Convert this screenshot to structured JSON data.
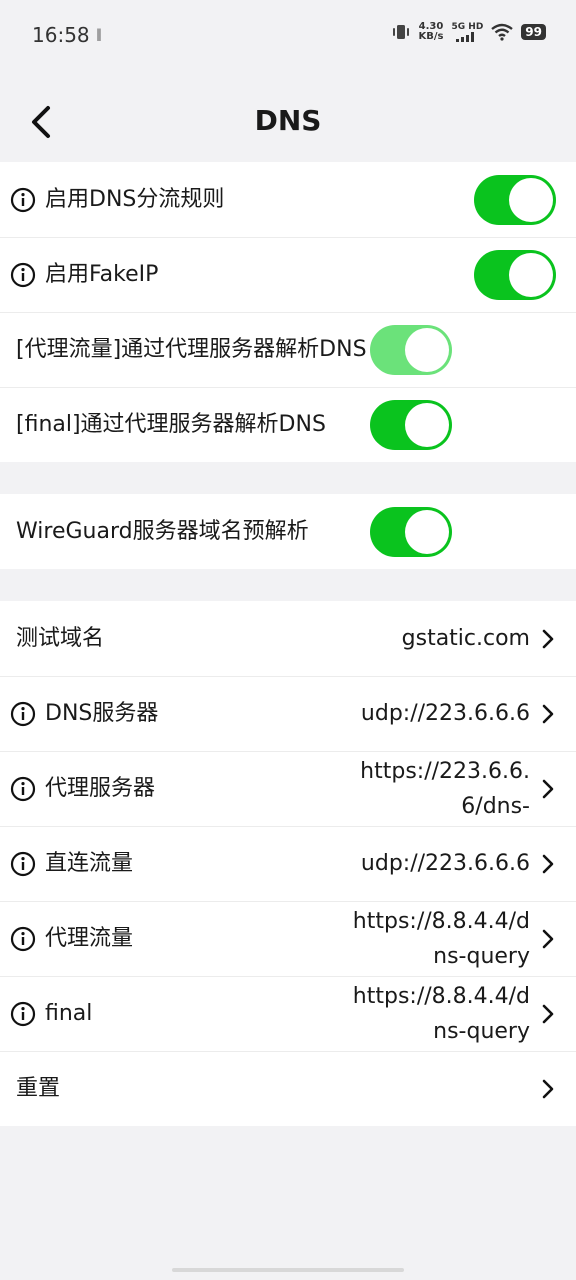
{
  "status_bar": {
    "time": "16:58",
    "dots": "‖",
    "speed_top": "4.30",
    "speed_bottom": "KB/s",
    "network": "5G HD",
    "battery": "99"
  },
  "header": {
    "title": "DNS"
  },
  "toggles_group1": [
    {
      "label": "启用DNS分流规则",
      "on": true,
      "info": true
    },
    {
      "label": "启用FakeIP",
      "on": true,
      "info": true
    },
    {
      "label": "[代理流量]通过代理服务器解析DNS",
      "on": true,
      "info": false,
      "dimmed": true
    },
    {
      "label": "[final]通过代理服务器解析DNS",
      "on": true,
      "info": false
    }
  ],
  "toggles_group2": [
    {
      "label": "WireGuard服务器域名预解析",
      "on": true,
      "info": false
    }
  ],
  "settings": [
    {
      "label": "测试域名",
      "value": "gstatic.com",
      "info": false
    },
    {
      "label": "DNS服务器",
      "value": "udp://223.6.6.6",
      "info": true
    },
    {
      "label": "代理服务器",
      "value": "https://223.6.6.6/dns-",
      "info": true
    },
    {
      "label": "直连流量",
      "value": "udp://223.6.6.6",
      "info": true
    },
    {
      "label": "代理流量",
      "value": "https://8.8.4.4/dns-query",
      "info": true
    },
    {
      "label": "final",
      "value": "https://8.8.4.4/dns-query",
      "info": true
    },
    {
      "label": "重置",
      "value": "",
      "info": false
    }
  ],
  "colors": {
    "toggle_on": "#0ac31e",
    "toggle_dim": "#6be27a",
    "background": "#f2f2f4"
  }
}
